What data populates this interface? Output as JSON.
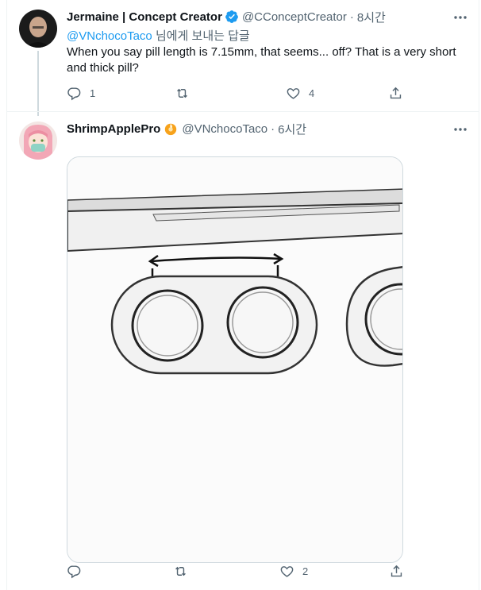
{
  "tweets": [
    {
      "author": "Jermaine | Concept Creator",
      "handle": "@CConceptCreator",
      "time": "8시간",
      "verified": true,
      "reply_mention": "@VNchocoTaco",
      "reply_suffix": " 님에게 보내는 답글",
      "text": "When you say pill length is 7.15mm, that seems... off? That is a very short and thick pill?",
      "reply_count": "1",
      "retweet_count": "",
      "like_count": "4"
    },
    {
      "author": "ShrimpApplePro",
      "emoji": "orange-emoji-icon",
      "handle": "@VNchocoTaco",
      "time": "6시간",
      "reply_count": "",
      "retweet_count": "",
      "like_count": "2"
    }
  ],
  "separator": "·",
  "colors": {
    "accent": "#1d9bf0",
    "secondary_text": "#536471",
    "border": "#eff3f4"
  }
}
